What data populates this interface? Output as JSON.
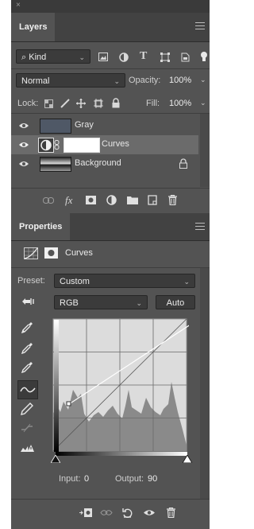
{
  "window": {
    "close_glyph": "×"
  },
  "layers_panel": {
    "tab_label": "Layers",
    "filter": {
      "kind_label": "Kind",
      "icons": [
        "image-filter-icon",
        "adjustment-filter-icon",
        "type-filter-icon",
        "shape-filter-icon",
        "smart-object-filter-icon",
        "filter-toggle-icon"
      ]
    },
    "blend_mode": "Normal",
    "opacity_label": "Opacity:",
    "opacity_value": "100%",
    "lock_label": "Lock:",
    "fill_label": "Fill:",
    "fill_value": "100%",
    "layers": [
      {
        "name": "Gray",
        "visible": true,
        "selected": false,
        "thumb_color": "#4f5866"
      },
      {
        "name": "Curves",
        "visible": true,
        "selected": true
      },
      {
        "name": "Background",
        "visible": true,
        "selected": false,
        "locked": true
      }
    ],
    "footer_icons": [
      "link-layers-icon",
      "fx-icon",
      "layer-mask-icon",
      "new-adjustment-icon",
      "new-group-icon",
      "new-layer-icon",
      "trash-icon"
    ],
    "fx_label": "fx"
  },
  "properties_panel": {
    "tab_label": "Properties",
    "title": "Curves",
    "preset_label": "Preset:",
    "preset_value": "Custom",
    "channel_value": "RGB",
    "auto_label": "Auto",
    "tools": [
      "on-image-adjust-icon",
      "black-point-eyedropper-icon",
      "gray-point-eyedropper-icon",
      "white-point-eyedropper-icon",
      "curve-points-icon",
      "pencil-icon",
      "smooth-icon",
      "clipping-warning-icon"
    ],
    "input_label": "Input:",
    "input_value": "0",
    "output_label": "Output:",
    "output_value": "90",
    "footer_icons": [
      "clip-to-layer-icon",
      "view-previous-icon",
      "reset-icon",
      "visibility-icon",
      "trash-icon"
    ]
  },
  "colors": {
    "panel": "#535353",
    "selected_row": "#6b6b6b",
    "dark_field": "#3b3b3b"
  }
}
